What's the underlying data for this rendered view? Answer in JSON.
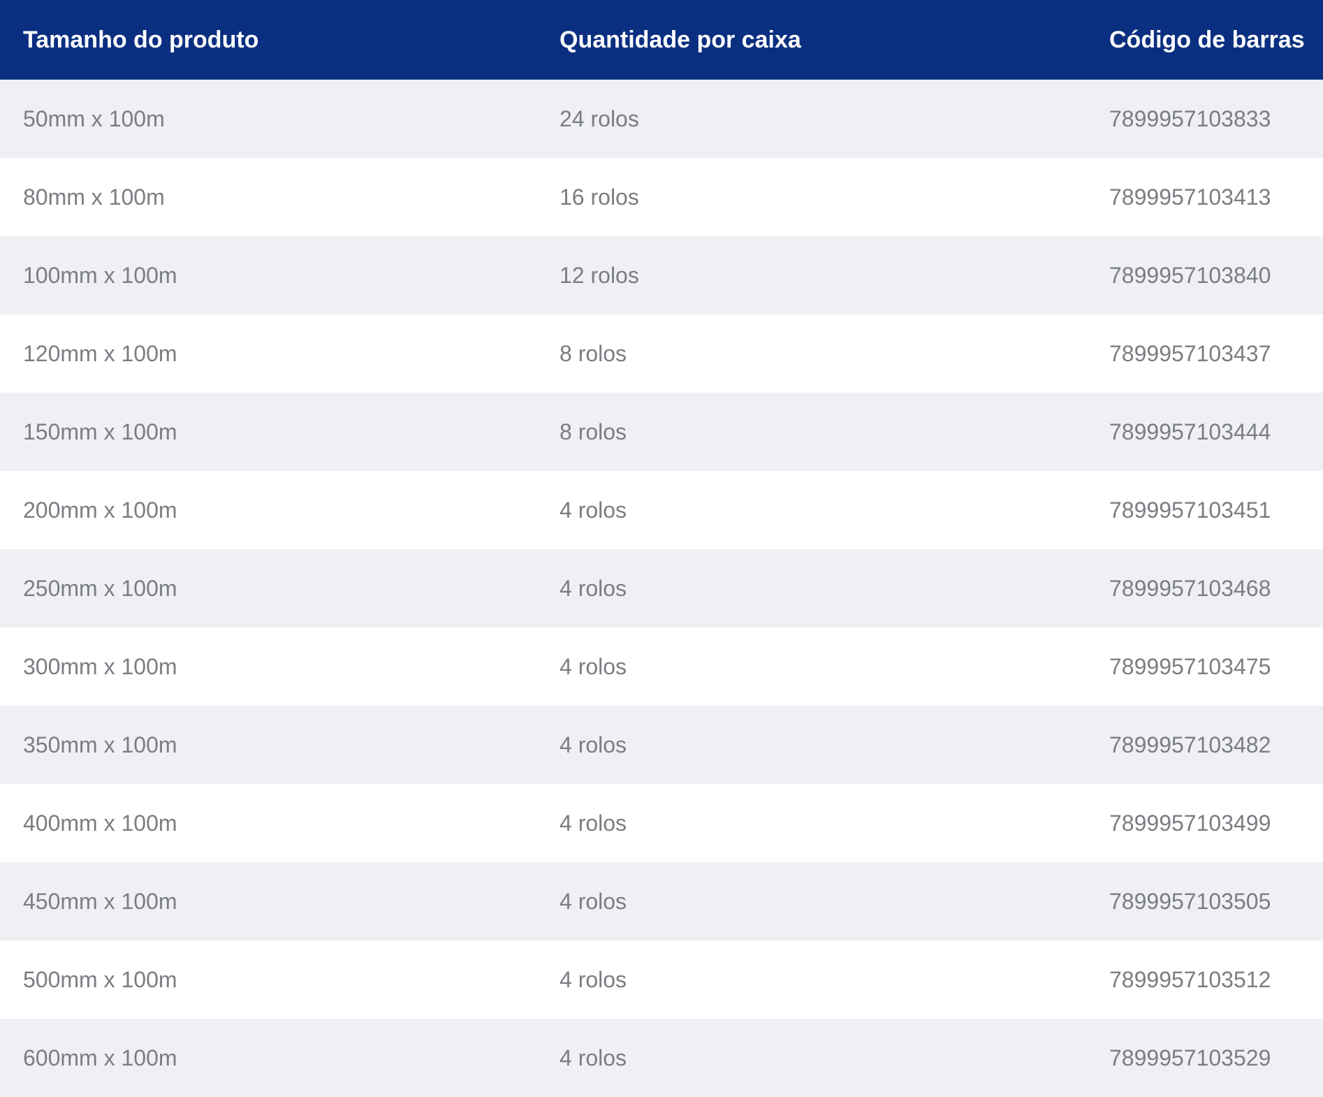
{
  "colors": {
    "header_bg": "#0b2f80",
    "header_text": "#ffffff",
    "row_alt_bg": "#eff0f4",
    "row_bg": "#ffffff",
    "cell_text": "#7a7d82"
  },
  "table": {
    "headers": [
      "Tamanho do produto",
      "Quantidade por caixa",
      "Código de barras"
    ],
    "rows": [
      {
        "size": "50mm x 100m",
        "qty": "24 rolos",
        "barcode": "7899957103833"
      },
      {
        "size": "80mm x 100m",
        "qty": "16 rolos",
        "barcode": "7899957103413"
      },
      {
        "size": "100mm x 100m",
        "qty": "12 rolos",
        "barcode": "7899957103840"
      },
      {
        "size": "120mm x 100m",
        "qty": "8 rolos",
        "barcode": "7899957103437"
      },
      {
        "size": "150mm x 100m",
        "qty": "8 rolos",
        "barcode": "7899957103444"
      },
      {
        "size": "200mm x 100m",
        "qty": "4 rolos",
        "barcode": "7899957103451"
      },
      {
        "size": "250mm x 100m",
        "qty": "4 rolos",
        "barcode": "7899957103468"
      },
      {
        "size": "300mm x 100m",
        "qty": "4 rolos",
        "barcode": "7899957103475"
      },
      {
        "size": "350mm x 100m",
        "qty": "4 rolos",
        "barcode": "7899957103482"
      },
      {
        "size": "400mm x 100m",
        "qty": "4 rolos",
        "barcode": "7899957103499"
      },
      {
        "size": "450mm x 100m",
        "qty": "4 rolos",
        "barcode": "7899957103505"
      },
      {
        "size": "500mm x 100m",
        "qty": "4 rolos",
        "barcode": "7899957103512"
      },
      {
        "size": "600mm x 100m",
        "qty": "4 rolos",
        "barcode": "7899957103529"
      }
    ]
  }
}
